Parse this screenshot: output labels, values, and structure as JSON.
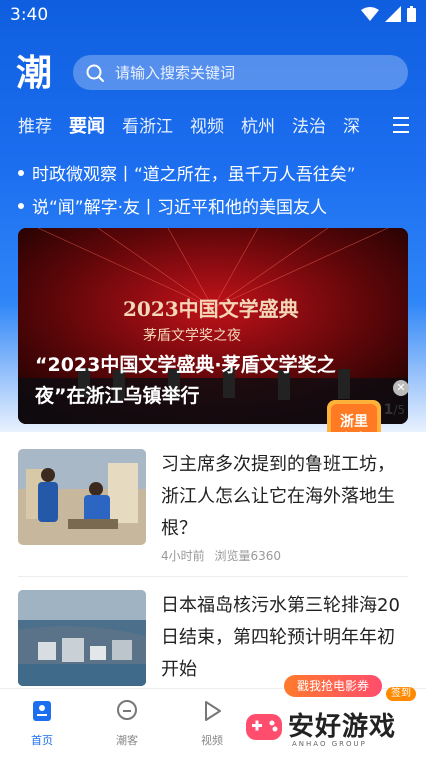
{
  "status": {
    "time": "3:40"
  },
  "header": {
    "logo_text": "潮",
    "search_placeholder": "请输入搜索关键词"
  },
  "tabs": [
    {
      "label": "推荐",
      "active": false
    },
    {
      "label": "要闻",
      "active": true
    },
    {
      "label": "看浙江",
      "active": false
    },
    {
      "label": "视频",
      "active": false
    },
    {
      "label": "杭州",
      "active": false
    },
    {
      "label": "法治",
      "active": false
    },
    {
      "label": "深",
      "active": false
    }
  ],
  "headlines": [
    "时政微观察丨“道之所在，虽千万人吾往矣”",
    "说“闻”解字·友丨习近平和他的美国友人"
  ],
  "banner": {
    "caption": "“2023中国文学盛典·茅盾文学奖之夜”在浙江乌镇举行",
    "poster_title": "2023中国文学盛典",
    "poster_sub": "茅盾文学奖之夜",
    "page_current": "1",
    "page_total": "/5",
    "badge_text": "浙里潮音"
  },
  "feed": [
    {
      "title": "习主席多次提到的鲁班工坊，浙江人怎么让它在海外落地生根？",
      "time": "4小时前",
      "views": "浏览量6360"
    },
    {
      "title": "日本福岛核污水第三轮排海20日结束，第四轮预计明年年初开始",
      "time": "",
      "views": ""
    }
  ],
  "navbar": [
    {
      "label": "首页",
      "icon": "home-icon",
      "active": true
    },
    {
      "label": "潮客",
      "icon": "chat-icon",
      "active": false
    },
    {
      "label": "视频",
      "icon": "play-icon",
      "active": false
    }
  ],
  "promo": {
    "label": "戳我抢电影券",
    "tag": "签到"
  },
  "watermark": {
    "text": "安好游戏",
    "sub": "ANHAO GROUP"
  },
  "colors": {
    "brand": "#1d6ff0",
    "text": "#222222",
    "meta": "#999999"
  }
}
